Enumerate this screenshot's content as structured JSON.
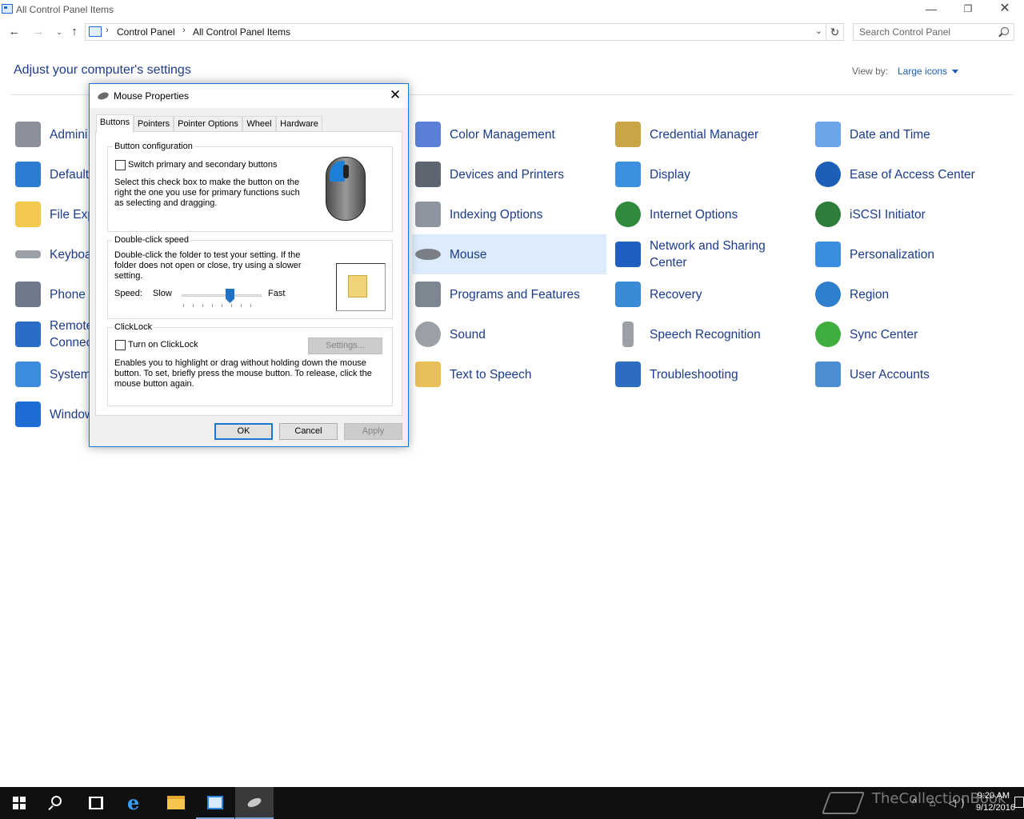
{
  "window": {
    "title": "All Control Panel Items",
    "minimize_glyph": "—",
    "restore_glyph": "❐",
    "close_glyph": "✕"
  },
  "nav": {
    "back_glyph": "←",
    "forward_glyph": "→",
    "recent_glyph": "⌄",
    "up_glyph": "↑",
    "refresh_glyph": "↻",
    "dropdown_glyph": "⌄",
    "breadcrumb": [
      "Control Panel",
      "All Control Panel Items"
    ],
    "separator": "›",
    "search_placeholder": "Search Control Panel"
  },
  "header": {
    "heading": "Adjust your computer's settings",
    "view_by_label": "View by:",
    "view_by_value": "Large icons"
  },
  "items": {
    "col1": [
      {
        "label": "Admini",
        "icon": "administrative-tools-icon",
        "color": "#8a8f99"
      },
      {
        "label": "Default",
        "icon": "default-programs-icon",
        "color": "#2e7bd6"
      },
      {
        "label": "File Exp",
        "icon": "file-explorer-options-icon",
        "color": "#f2c94c"
      },
      {
        "label": "Keyboa",
        "icon": "keyboard-icon",
        "color": "#9aa0a6"
      },
      {
        "label": "Phone",
        "icon": "phone-modem-icon",
        "color": "#6e7a8a"
      },
      {
        "label": "Remote Connec",
        "icon": "remoteapp-icon",
        "color": "#2a6cc9"
      },
      {
        "label": "System",
        "icon": "system-icon",
        "color": "#3c8de0"
      },
      {
        "label": "Window",
        "icon": "windows-firewall-icon",
        "color": "#1e6bd6"
      }
    ],
    "col2": [
      {
        "label": "Color Management",
        "icon": "color-management-icon",
        "color": "#5b7fd6"
      },
      {
        "label": "Devices and Printers",
        "icon": "devices-printers-icon",
        "color": "#5d6670"
      },
      {
        "label": "Indexing Options",
        "icon": "indexing-options-icon",
        "color": "#8c95a0"
      },
      {
        "label": "Mouse",
        "icon": "mouse-icon",
        "color": "#7a7f86"
      },
      {
        "label": "Programs and Features",
        "icon": "programs-features-icon",
        "color": "#7d8791"
      },
      {
        "label": "Sound",
        "icon": "sound-icon",
        "color": "#9b9fa6"
      },
      {
        "label": "Text to Speech",
        "icon": "text-to-speech-icon",
        "color": "#e8c05a"
      }
    ],
    "col3": [
      {
        "label": "Credential Manager",
        "icon": "credential-manager-icon",
        "color": "#c9a545"
      },
      {
        "label": "Display",
        "icon": "display-icon",
        "color": "#3d8fe0"
      },
      {
        "label": "Internet Options",
        "icon": "internet-options-icon",
        "color": "#2f8a3c"
      },
      {
        "label": "Network and Sharing Center",
        "icon": "network-sharing-icon",
        "color": "#1f5fbf"
      },
      {
        "label": "Recovery",
        "icon": "recovery-icon",
        "color": "#3b8ad8"
      },
      {
        "label": "Speech Recognition",
        "icon": "speech-recognition-icon",
        "color": "#9aa0a6"
      },
      {
        "label": "Troubleshooting",
        "icon": "troubleshooting-icon",
        "color": "#2d6cc0"
      }
    ],
    "col4": [
      {
        "label": "Date and Time",
        "icon": "date-time-icon",
        "color": "#6aa6e8"
      },
      {
        "label": "Ease of Access Center",
        "icon": "ease-of-access-icon",
        "color": "#1c5fb8"
      },
      {
        "label": "iSCSI Initiator",
        "icon": "iscsi-initiator-icon",
        "color": "#2f7d3a"
      },
      {
        "label": "Personalization",
        "icon": "personalization-icon",
        "color": "#3a8de0"
      },
      {
        "label": "Region",
        "icon": "region-icon",
        "color": "#2f7fcf"
      },
      {
        "label": "Sync Center",
        "icon": "sync-center-icon",
        "color": "#3fae3f"
      },
      {
        "label": "User Accounts",
        "icon": "user-accounts-icon",
        "color": "#4c8cd0"
      }
    ],
    "selected": "Mouse"
  },
  "dialog": {
    "title": "Mouse Properties",
    "close_glyph": "✕",
    "tabs": [
      "Buttons",
      "Pointers",
      "Pointer Options",
      "Wheel",
      "Hardware"
    ],
    "active_tab": "Buttons",
    "button_config": {
      "title": "Button configuration",
      "checkbox_label": "Switch primary and secondary buttons",
      "checked": false,
      "description": "Select this check box to make the button on the right the one you use for primary functions such as selecting and dragging."
    },
    "double_click": {
      "title": "Double-click speed",
      "description": "Double-click the folder to test your setting. If the folder does not open or close, try using a slower setting.",
      "speed_label": "Speed:",
      "slow_label": "Slow",
      "fast_label": "Fast",
      "speed_fraction": 0.6
    },
    "clicklock": {
      "title": "ClickLock",
      "checkbox_label": "Turn on ClickLock",
      "checked": false,
      "settings_button": "Settings...",
      "description": "Enables you to highlight or drag without holding down the mouse button. To set, briefly press the mouse button. To release, click the mouse button again."
    },
    "buttons": {
      "ok": "OK",
      "cancel": "Cancel",
      "apply": "Apply"
    }
  },
  "taskbar": {
    "time": "9:20 AM",
    "date": "9/12/2016",
    "tray_glyphs": "^ ⌂ ◁)",
    "watermark": "TheCollectionBook"
  }
}
